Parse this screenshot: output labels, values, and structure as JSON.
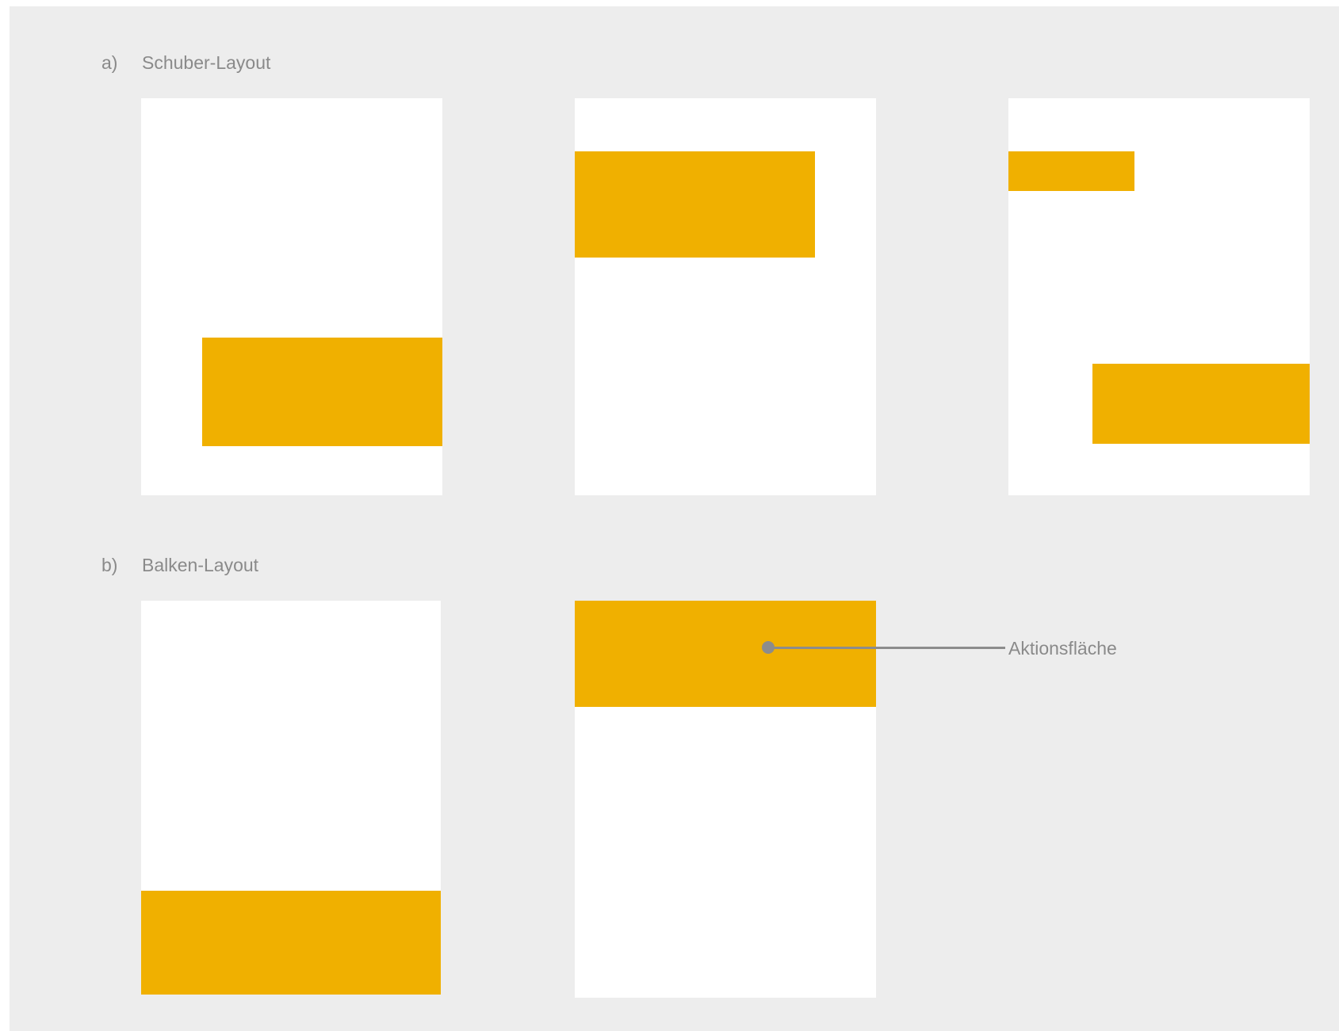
{
  "colors": {
    "background": "#ededed",
    "page": "#ffffff",
    "action_area": "#f0b000",
    "label": "#8a8a8a",
    "callout": "#8c8c8c"
  },
  "sections": [
    {
      "marker": "a)",
      "title": "Schuber-Layout"
    },
    {
      "marker": "b)",
      "title": "Balken-Layout"
    }
  ],
  "callout": {
    "label": "Aktionsfläche"
  }
}
